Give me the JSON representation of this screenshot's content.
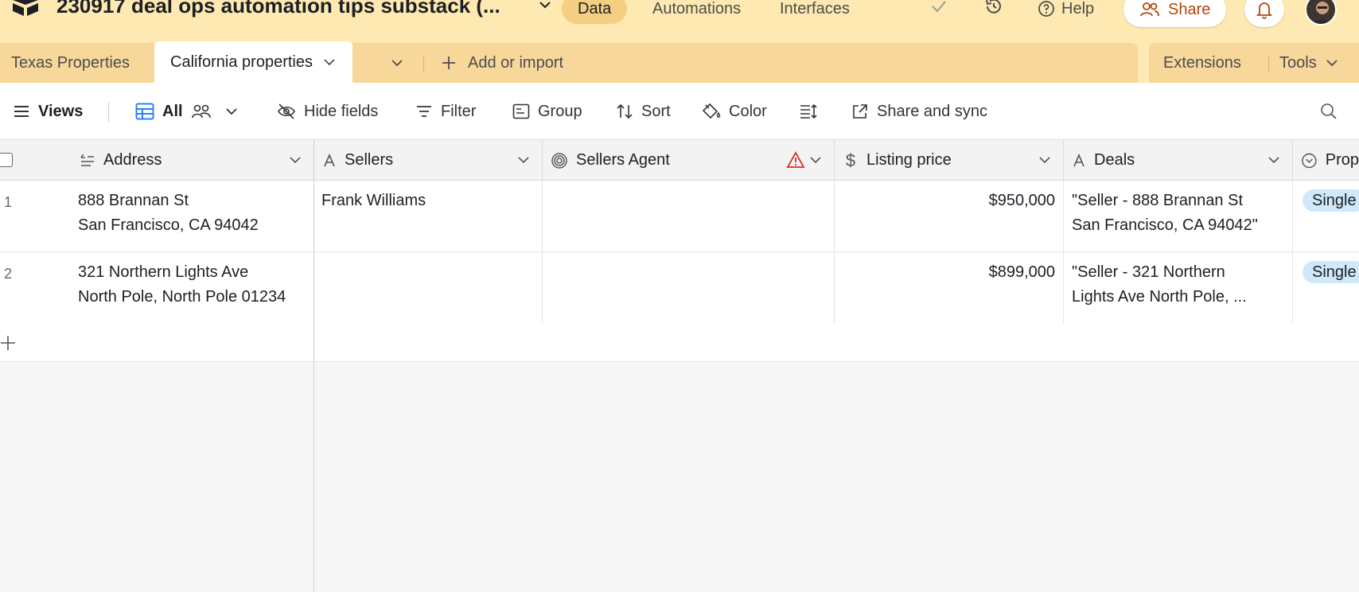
{
  "header": {
    "base_title": "230917 deal ops automation tips substack (...",
    "nav": [
      "Data",
      "Automations",
      "Interfaces"
    ],
    "help_label": "Help",
    "share_label": "Share"
  },
  "tabs": {
    "items": [
      "Texas Properties",
      "California properties"
    ],
    "add_label": "Add or import",
    "extensions_label": "Extensions",
    "tools_label": "Tools"
  },
  "toolbar": {
    "views_label": "Views",
    "view_name": "All",
    "hide_fields": "Hide fields",
    "filter": "Filter",
    "group": "Group",
    "sort": "Sort",
    "color": "Color",
    "share_sync": "Share and sync"
  },
  "table": {
    "columns": [
      "Address",
      "Sellers",
      "Sellers Agent",
      "Listing price",
      "Deals",
      "Prop"
    ],
    "rows": [
      {
        "num": "1",
        "address_line1": "888 Brannan St",
        "address_line2": "San Francisco, CA 94042",
        "sellers": "Frank Williams",
        "agent": "",
        "price": "$950,000",
        "deals_line1": "\"Seller - 888 Brannan St",
        "deals_line2": "San Francisco, CA 94042\"",
        "prop": "Single"
      },
      {
        "num": "2",
        "address_line1": "321 Northern Lights Ave",
        "address_line2": "North Pole, North Pole 01234",
        "sellers": "",
        "agent": "",
        "price": "$899,000",
        "deals_line1": "\"Seller - 321 Northern",
        "deals_line2": "Lights Ave North Pole, ...",
        "prop": "Single"
      }
    ]
  },
  "icons": {
    "logo": "airtable-logo-icon",
    "history": "history-icon",
    "check": "check-icon",
    "bell": "bell-icon",
    "search": "search-icon"
  },
  "colors": {
    "topbar": "#fde9b1",
    "tabstrip": "#f7d79a",
    "active_nav": "#f4cf83",
    "share_text": "#b54708",
    "warning": "#d92d20",
    "pill": "#cfe9fb",
    "view_icon": "#2d7ff9"
  }
}
